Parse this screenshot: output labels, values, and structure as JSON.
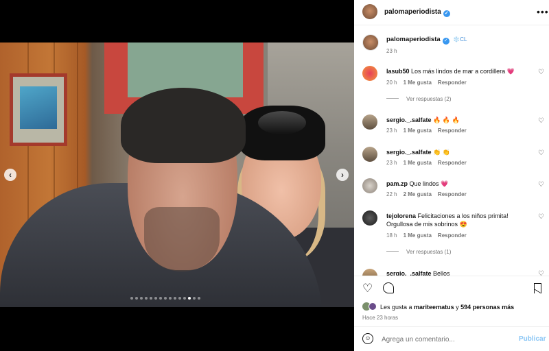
{
  "post": {
    "author": "palomaperiodista",
    "caption_time": "23 h",
    "caption_badges": "❄️CL",
    "carousel_total": 15,
    "carousel_active": 13,
    "prev_icon": "chevron-left-icon",
    "next_icon": "chevron-right-icon"
  },
  "header": {
    "username": "palomaperiodista",
    "more": "•••"
  },
  "comments": [
    {
      "user": "lasub50",
      "text": "Los más lindos de mar a cordillera ",
      "emoji": "💗",
      "time": "20 h",
      "likes": "1 Me gusta",
      "reply": "Responder",
      "replies_label": "Ver respuestas (2)"
    },
    {
      "user": "sergio._.salfate",
      "text": "",
      "emoji": "🔥 🔥 🔥",
      "time": "23 h",
      "likes": "1 Me gusta",
      "reply": "Responder"
    },
    {
      "user": "sergio._.salfate",
      "text": "",
      "emoji": "👏 👏",
      "time": "23 h",
      "likes": "1 Me gusta",
      "reply": "Responder"
    },
    {
      "user": "pam.zp",
      "text": "Que lindos ",
      "emoji": "💗",
      "time": "22 h",
      "likes": "2 Me gusta",
      "reply": "Responder"
    },
    {
      "user": "tejolorena",
      "text": "Felicitaciones a los niños primita! Orgullosa de mis sobrinos ",
      "emoji": "😍",
      "time": "18 h",
      "likes": "1 Me gusta",
      "reply": "Responder",
      "replies_label": "Ver respuestas (1)"
    },
    {
      "user": "sergio._.salfate",
      "text": "Bellos",
      "emoji": "",
      "time": "",
      "likes": "",
      "reply": ""
    }
  ],
  "actions": {
    "likes_prefix": "Les gusta a ",
    "liker": "mariteematus",
    "likes_mid": " y ",
    "others": "594 personas más",
    "time_ago": "Hace 23 horas"
  },
  "composer": {
    "placeholder": "Agrega un comentario...",
    "publish": "Publicar"
  },
  "colors": {
    "verified": "#3897f0",
    "publish": "#8ac6f5",
    "muted": "#737373"
  }
}
